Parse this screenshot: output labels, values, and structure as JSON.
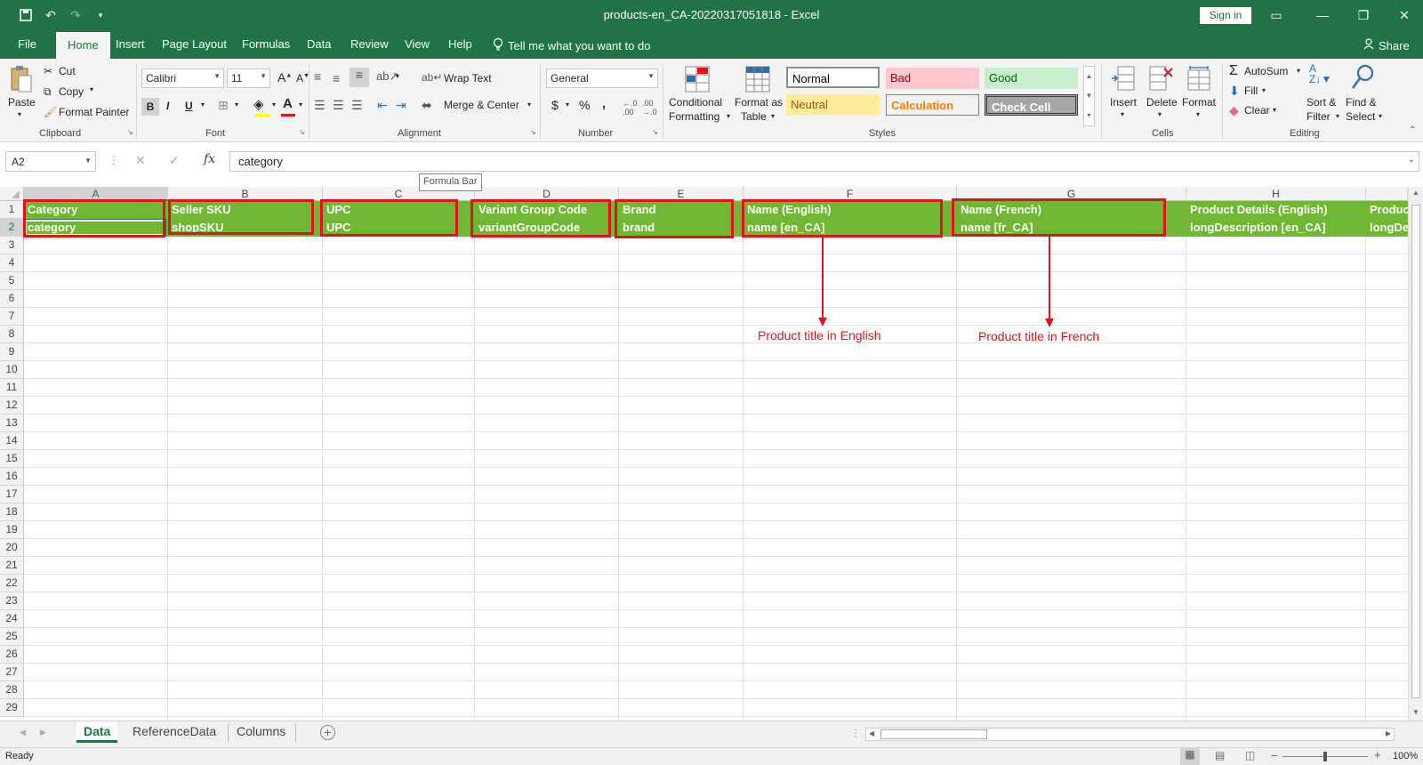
{
  "window": {
    "title": "products-en_CA-20220317051818  -  Excel",
    "sign_in": "Sign in",
    "share": "Share"
  },
  "tabs": [
    "File",
    "Home",
    "Insert",
    "Page Layout",
    "Formulas",
    "Data",
    "Review",
    "View",
    "Help"
  ],
  "tell_me": "Tell me what you want to do",
  "ribbon": {
    "clipboard": {
      "paste": "Paste",
      "cut": "Cut",
      "copy": "Copy",
      "format_painter": "Format Painter",
      "label": "Clipboard"
    },
    "font": {
      "name": "Calibri",
      "size": "11",
      "label": "Font",
      "bold": "B",
      "italic": "I",
      "underline": "U"
    },
    "alignment": {
      "wrap": "Wrap Text",
      "merge": "Merge & Center",
      "label": "Alignment"
    },
    "number": {
      "format": "General",
      "label": "Number",
      "currency": "$",
      "percent": "%",
      "comma": ","
    },
    "styles": {
      "conditional": "Conditional",
      "conditional2": "Formatting",
      "format_as": "Format as",
      "format_as2": "Table",
      "label": "Styles",
      "normal": "Normal",
      "bad": "Bad",
      "good": "Good",
      "neutral": "Neutral",
      "calculation": "Calculation",
      "check": "Check Cell"
    },
    "cells": {
      "insert": "Insert",
      "delete": "Delete",
      "format": "Format",
      "label": "Cells"
    },
    "editing": {
      "autosum": "AutoSum",
      "fill": "Fill",
      "clear": "Clear",
      "sort": "Sort &",
      "sort2": "Filter",
      "find": "Find &",
      "find2": "Select",
      "label": "Editing"
    }
  },
  "formula_bar": {
    "name_box": "A2",
    "fx": "fx",
    "value": "category",
    "tooltip": "Formula Bar"
  },
  "columns": [
    "A",
    "B",
    "C",
    "D",
    "E",
    "F",
    "G",
    "H"
  ],
  "rows": [
    "1",
    "2",
    "3",
    "4",
    "5",
    "6",
    "7",
    "8",
    "9",
    "10",
    "11",
    "12",
    "13",
    "14",
    "15",
    "16",
    "17",
    "18",
    "19",
    "20",
    "21",
    "22",
    "23",
    "24",
    "25",
    "26",
    "27",
    "28",
    "29"
  ],
  "row1": [
    "Category",
    "Seller SKU",
    "UPC",
    "Variant Group Code",
    "Brand",
    "Name (English)",
    "Name (French)",
    "Product Details (English)",
    "Produc"
  ],
  "row2": [
    "category",
    "shopSKU",
    "UPC",
    "variantGroupCode",
    "brand",
    "name [en_CA]",
    "name [fr_CA]",
    "longDescription [en_CA]",
    "longDe"
  ],
  "annotations": {
    "english": "Product title in English",
    "french": "Product title in French"
  },
  "sheets": [
    "Data",
    "ReferenceData",
    "Columns"
  ],
  "status": {
    "ready": "Ready",
    "zoom": "100%"
  },
  "colors": {
    "excel_green": "#217346",
    "header_fill": "#70b833",
    "annotation_red": "#e3121b"
  }
}
